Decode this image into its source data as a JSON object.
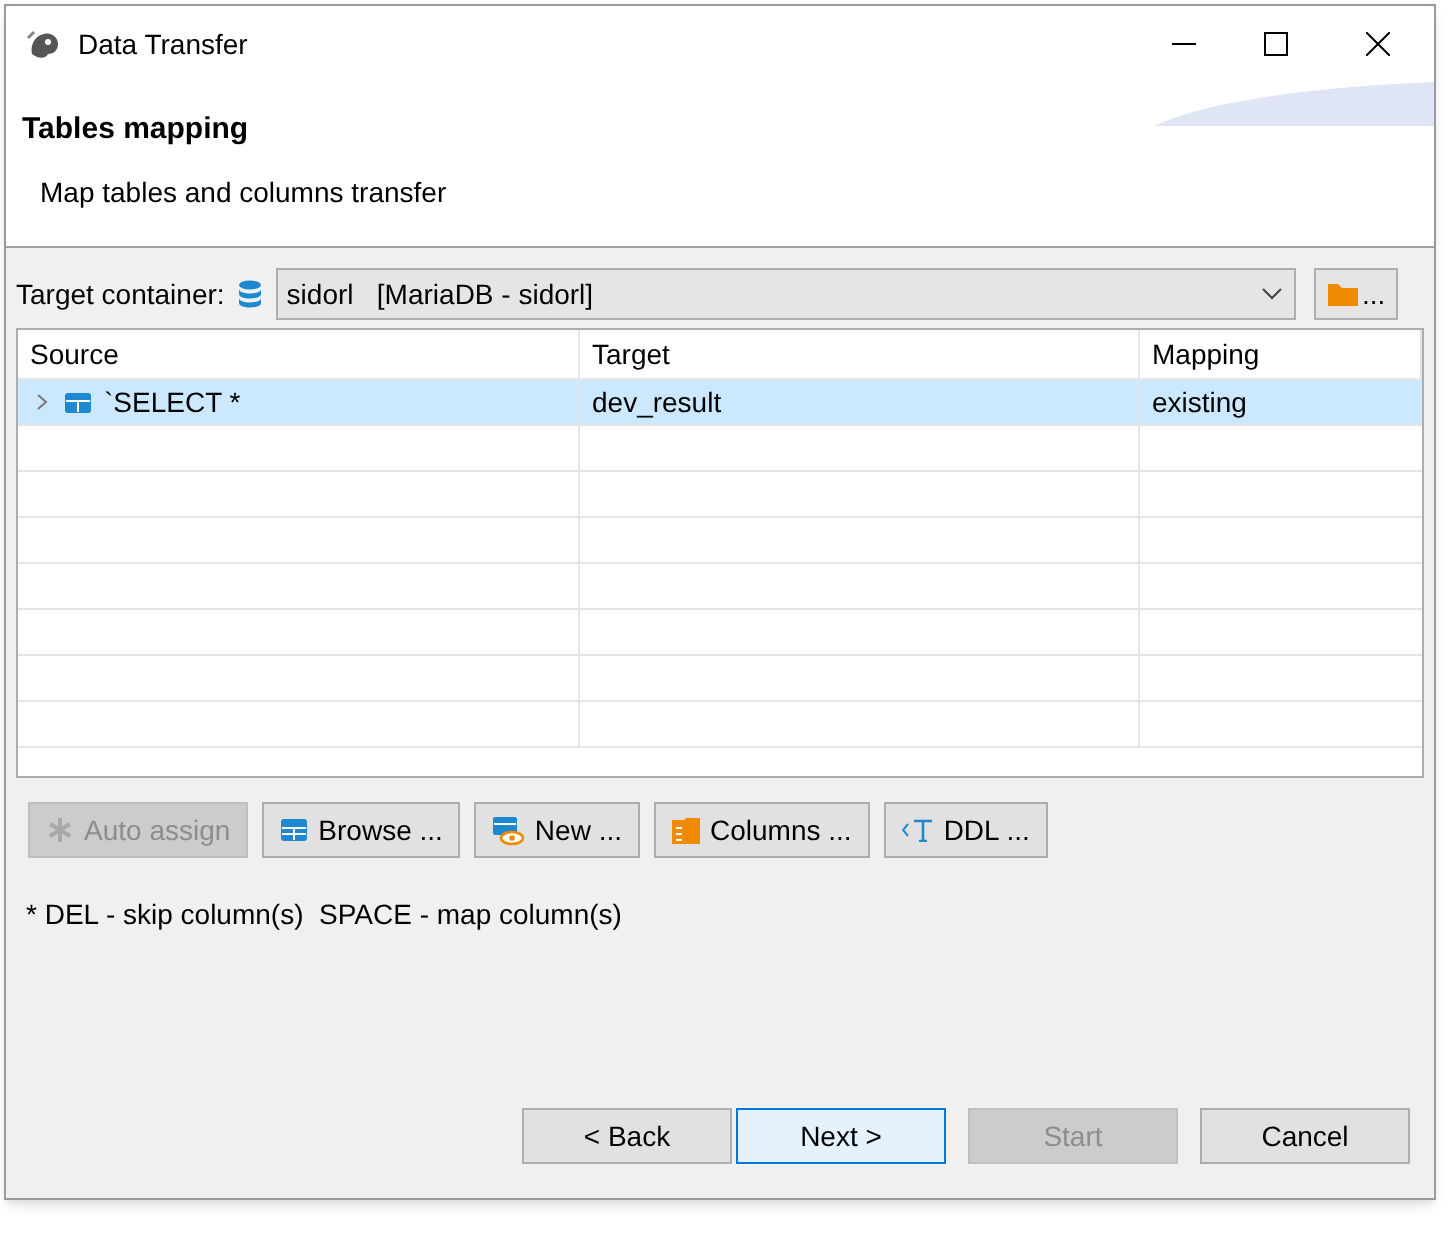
{
  "window": {
    "title": "Data Transfer"
  },
  "header": {
    "title": "Tables mapping",
    "description": "Map tables and columns transfer"
  },
  "target_container": {
    "label": "Target container:",
    "value": "sidorl   [MariaDB - sidorl]",
    "browse_label": "..."
  },
  "table": {
    "columns": [
      "Source",
      "Target",
      "Mapping"
    ],
    "rows": [
      {
        "source": "`SELECT *",
        "target": "dev_result",
        "mapping": "existing",
        "selected": true,
        "expanded": false
      }
    ]
  },
  "actions": [
    {
      "kind": "auto",
      "label": "Auto assign",
      "disabled": true
    },
    {
      "kind": "browse",
      "label": "Browse ...",
      "disabled": false
    },
    {
      "kind": "new",
      "label": "New ...",
      "disabled": false
    },
    {
      "kind": "columns",
      "label": "Columns ...",
      "disabled": false
    },
    {
      "kind": "ddl",
      "label": "DDL ...",
      "disabled": false
    }
  ],
  "hint": "* DEL - skip column(s)  SPACE - map column(s)",
  "footer_buttons": [
    {
      "label": "< Back",
      "disabled": false,
      "default": false
    },
    {
      "label": "Next >",
      "disabled": false,
      "default": true
    },
    {
      "label": "Start",
      "disabled": true,
      "default": false
    },
    {
      "label": "Cancel",
      "disabled": false,
      "default": false
    }
  ]
}
